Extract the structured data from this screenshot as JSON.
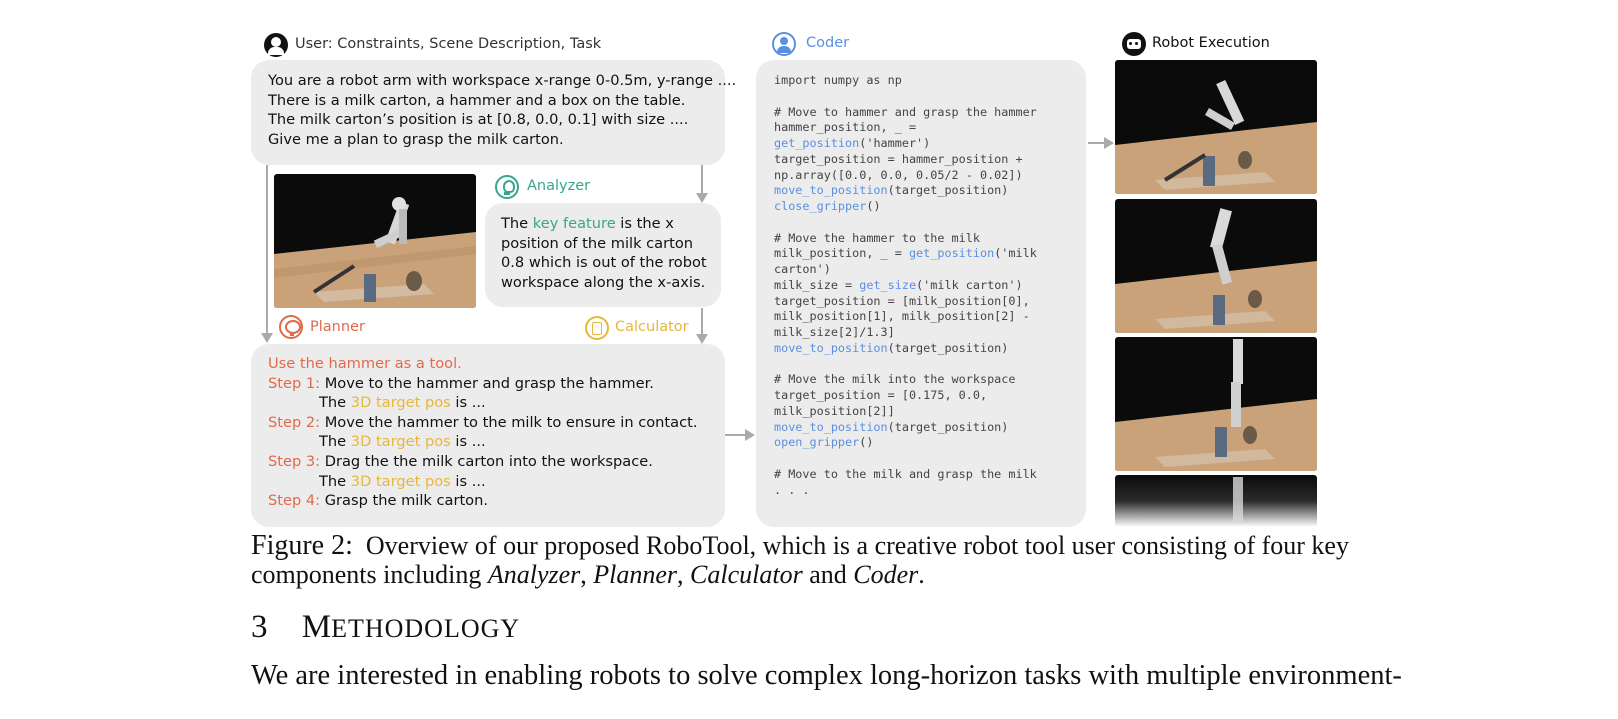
{
  "figure": {
    "user": {
      "header": "User: Constraints, Scene Description, Task",
      "lines": [
        "You are a robot arm with workspace x-range 0-0.5m, y-range ....",
        "There is a milk carton, a hammer and a box on the table.",
        "The milk carton’s position is at [0.8, 0.0, 0.1] with size ....",
        "Give me a plan to grasp the milk carton."
      ]
    },
    "analyzer": {
      "header": "Analyzer",
      "text_pre": "The ",
      "text_highlight": "key feature",
      "text_post": " is the x position of the milk carton 0.8 which is out of the robot workspace along the x-axis."
    },
    "planner": {
      "header": "Planner",
      "intro": "Use the hammer as a tool.",
      "steps": [
        {
          "label": "Step 1:",
          "text": "Move to the hammer and grasp the hammer.",
          "sub": true
        },
        {
          "label": "Step 2:",
          "text": "Move the hammer to the milk to ensure in contact.",
          "sub": true
        },
        {
          "label": "Step 3:",
          "text": "Drag the the milk carton into the workspace.",
          "sub": true
        },
        {
          "label": "Step 4:",
          "text": "Grasp the milk carton.",
          "sub": false
        }
      ],
      "sub_pre": "The ",
      "sub_highlight": "3D target pos",
      "sub_post": " is ..."
    },
    "calculator": {
      "header": "Calculator"
    },
    "coder": {
      "header": "Coder",
      "lines": [
        [
          {
            "t": "import numpy as np"
          }
        ],
        [],
        [
          {
            "t": "# Move to hammer and grasp the hammer"
          }
        ],
        [
          {
            "t": "hammer_position, _ ="
          }
        ],
        [
          {
            "t": "get_position",
            "fn": true
          },
          {
            "t": "('hammer')"
          }
        ],
        [
          {
            "t": "target_position = hammer_position +"
          }
        ],
        [
          {
            "t": "np.array([0.0, 0.0, 0.05/2 - 0.02])"
          }
        ],
        [
          {
            "t": "move_to_position",
            "fn": true
          },
          {
            "t": "(target_position)"
          }
        ],
        [
          {
            "t": "close_gripper",
            "fn": true
          },
          {
            "t": "()"
          }
        ],
        [],
        [
          {
            "t": "# Move the hammer to the milk"
          }
        ],
        [
          {
            "t": "milk_position, _ = "
          },
          {
            "t": "get_position",
            "fn": true
          },
          {
            "t": "('milk"
          }
        ],
        [
          {
            "t": "carton')"
          }
        ],
        [
          {
            "t": "milk_size = "
          },
          {
            "t": "get_size",
            "fn": true
          },
          {
            "t": "('milk carton')"
          }
        ],
        [
          {
            "t": "target_position = [milk_position[0],"
          }
        ],
        [
          {
            "t": "milk_position[1], milk_position[2] -"
          }
        ],
        [
          {
            "t": "milk_size[2]/1.3]"
          }
        ],
        [
          {
            "t": "move_to_position",
            "fn": true
          },
          {
            "t": "(target_position)"
          }
        ],
        [],
        [
          {
            "t": "# Move the milk into the workspace"
          }
        ],
        [
          {
            "t": "target_position = [0.175, 0.0,"
          }
        ],
        [
          {
            "t": "milk_position[2]]"
          }
        ],
        [
          {
            "t": "move_to_position",
            "fn": true
          },
          {
            "t": "(target_position)"
          }
        ],
        [
          {
            "t": "open_gripper",
            "fn": true
          },
          {
            "t": "()"
          }
        ],
        [],
        [
          {
            "t": "# Move to the milk and grasp the milk"
          }
        ],
        [
          {
            "t": ". . ."
          }
        ]
      ]
    },
    "robot": {
      "header": "Robot Execution"
    }
  },
  "caption": {
    "label": "Figure 2:",
    "text1": "Overview of our proposed RoboTool, which is a creative robot tool user consisting of four key",
    "text2_pre": "components including ",
    "analyzer": "Analyzer",
    "planner": "Planner",
    "calculator": "Calculator",
    "and": "and",
    "coder": "Coder"
  },
  "section": {
    "number": "3",
    "title_first": "M",
    "title_rest": "ETHODOLOGY"
  },
  "body": "We are interested in enabling robots to solve complex long-horizon tasks with multiple environment-",
  "colors": {
    "planner_red": "#e2694b",
    "calculator_yellow": "#e8b63c",
    "analyzer_green": "#3aa58b",
    "coder_blue": "#5b8fe0",
    "bubble": "#ececec"
  }
}
